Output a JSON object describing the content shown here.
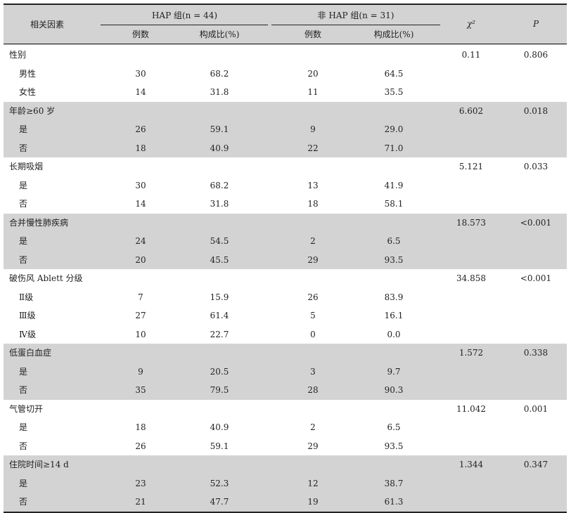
{
  "header": {
    "factor": "相关因素",
    "hap_group": "HAP 组(n = 44)",
    "nonhap_group": "非 HAP 组(n = 31)",
    "count": "例数",
    "ratio": "构成比(%)",
    "chi2": "χ²",
    "p": "P"
  },
  "rows": [
    {
      "label": "性别",
      "n1": "",
      "p1": "",
      "n2": "",
      "p2": "",
      "chi": "0.11",
      "pv": "0.806",
      "sub": false,
      "shaded": false
    },
    {
      "label": "男性",
      "n1": "30",
      "p1": "68.2",
      "n2": "20",
      "p2": "64.5",
      "chi": "",
      "pv": "",
      "sub": true,
      "shaded": false
    },
    {
      "label": "女性",
      "n1": "14",
      "p1": "31.8",
      "n2": "11",
      "p2": "35.5",
      "chi": "",
      "pv": "",
      "sub": true,
      "shaded": false
    },
    {
      "label": "年龄≥60 岁",
      "n1": "",
      "p1": "",
      "n2": "",
      "p2": "",
      "chi": "6.602",
      "pv": "0.018",
      "sub": false,
      "shaded": true
    },
    {
      "label": "是",
      "n1": "26",
      "p1": "59.1",
      "n2": "9",
      "p2": "29.0",
      "chi": "",
      "pv": "",
      "sub": true,
      "shaded": true
    },
    {
      "label": "否",
      "n1": "18",
      "p1": "40.9",
      "n2": "22",
      "p2": "71.0",
      "chi": "",
      "pv": "",
      "sub": true,
      "shaded": true
    },
    {
      "label": "长期吸烟",
      "n1": "",
      "p1": "",
      "n2": "",
      "p2": "",
      "chi": "5.121",
      "pv": "0.033",
      "sub": false,
      "shaded": false
    },
    {
      "label": "是",
      "n1": "30",
      "p1": "68.2",
      "n2": "13",
      "p2": "41.9",
      "chi": "",
      "pv": "",
      "sub": true,
      "shaded": false
    },
    {
      "label": "否",
      "n1": "14",
      "p1": "31.8",
      "n2": "18",
      "p2": "58.1",
      "chi": "",
      "pv": "",
      "sub": true,
      "shaded": false
    },
    {
      "label": "合并慢性肺疾病",
      "n1": "",
      "p1": "",
      "n2": "",
      "p2": "",
      "chi": "18.573",
      "pv": "<0.001",
      "sub": false,
      "shaded": true
    },
    {
      "label": "是",
      "n1": "24",
      "p1": "54.5",
      "n2": "2",
      "p2": "6.5",
      "chi": "",
      "pv": "",
      "sub": true,
      "shaded": true
    },
    {
      "label": "否",
      "n1": "20",
      "p1": "45.5",
      "n2": "29",
      "p2": "93.5",
      "chi": "",
      "pv": "",
      "sub": true,
      "shaded": true
    },
    {
      "label": "破伤风 Ablett 分级",
      "n1": "",
      "p1": "",
      "n2": "",
      "p2": "",
      "chi": "34.858",
      "pv": "<0.001",
      "sub": false,
      "shaded": false
    },
    {
      "label": "Ⅱ级",
      "n1": "7",
      "p1": "15.9",
      "n2": "26",
      "p2": "83.9",
      "chi": "",
      "pv": "",
      "sub": true,
      "shaded": false
    },
    {
      "label": "Ⅲ级",
      "n1": "27",
      "p1": "61.4",
      "n2": "5",
      "p2": "16.1",
      "chi": "",
      "pv": "",
      "sub": true,
      "shaded": false
    },
    {
      "label": "Ⅳ级",
      "n1": "10",
      "p1": "22.7",
      "n2": "0",
      "p2": "0.0",
      "chi": "",
      "pv": "",
      "sub": true,
      "shaded": false
    },
    {
      "label": "低蛋白血症",
      "n1": "",
      "p1": "",
      "n2": "",
      "p2": "",
      "chi": "1.572",
      "pv": "0.338",
      "sub": false,
      "shaded": true
    },
    {
      "label": "是",
      "n1": "9",
      "p1": "20.5",
      "n2": "3",
      "p2": "9.7",
      "chi": "",
      "pv": "",
      "sub": true,
      "shaded": true
    },
    {
      "label": "否",
      "n1": "35",
      "p1": "79.5",
      "n2": "28",
      "p2": "90.3",
      "chi": "",
      "pv": "",
      "sub": true,
      "shaded": true
    },
    {
      "label": "气管切开",
      "n1": "",
      "p1": "",
      "n2": "",
      "p2": "",
      "chi": "11.042",
      "pv": "0.001",
      "sub": false,
      "shaded": false
    },
    {
      "label": "是",
      "n1": "18",
      "p1": "40.9",
      "n2": "2",
      "p2": "6.5",
      "chi": "",
      "pv": "",
      "sub": true,
      "shaded": false
    },
    {
      "label": "否",
      "n1": "26",
      "p1": "59.1",
      "n2": "29",
      "p2": "93.5",
      "chi": "",
      "pv": "",
      "sub": true,
      "shaded": false
    },
    {
      "label": "住院时间≥14 d",
      "n1": "",
      "p1": "",
      "n2": "",
      "p2": "",
      "chi": "1.344",
      "pv": "0.347",
      "sub": false,
      "shaded": true
    },
    {
      "label": "是",
      "n1": "23",
      "p1": "52.3",
      "n2": "12",
      "p2": "38.7",
      "chi": "",
      "pv": "",
      "sub": true,
      "shaded": true
    },
    {
      "label": "否",
      "n1": "21",
      "p1": "47.7",
      "n2": "19",
      "p2": "61.3",
      "chi": "",
      "pv": "",
      "sub": true,
      "shaded": true
    }
  ]
}
